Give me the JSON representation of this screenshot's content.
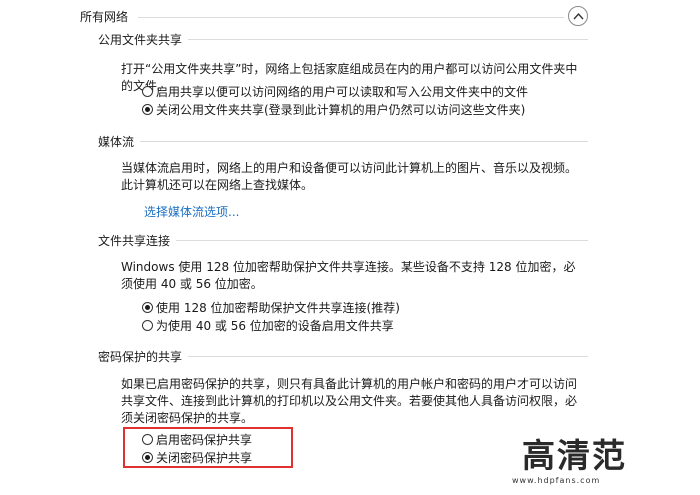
{
  "header": {
    "title": "所有网络",
    "collapse_icon": "chevron-up-icon"
  },
  "public_folder": {
    "title": "公用文件夹共享",
    "desc": "打开“公用文件夹共享”时，网络上包括家庭组成员在内的用户都可以访问公用文件夹中的文件。",
    "options": [
      {
        "label": "启用共享以便可以访问网络的用户可以读取和写入公用文件夹中的文件",
        "checked": false
      },
      {
        "label": "关闭公用文件夹共享(登录到此计算机的用户仍然可以访问这些文件夹)",
        "checked": true
      }
    ]
  },
  "media": {
    "title": "媒体流",
    "desc": "当媒体流启用时，网络上的用户和设备便可以访问此计算机上的图片、音乐以及视频。此计算机还可以在网络上查找媒体。",
    "link": "选择媒体流选项..."
  },
  "file_sharing": {
    "title": "文件共享连接",
    "desc": "Windows 使用 128 位加密帮助保护文件共享连接。某些设备不支持 128 位加密，必须使用 40 或 56 位加密。",
    "options": [
      {
        "label": "使用 128 位加密帮助保护文件共享连接(推荐)",
        "checked": true
      },
      {
        "label": "为使用 40 或 56 位加密的设备启用文件共享",
        "checked": false
      }
    ]
  },
  "password": {
    "title": "密码保护的共享",
    "desc": "如果已启用密码保护的共享，则只有具备此计算机的用户帐户和密码的用户才可以访问共享文件、连接到此计算机的打印机以及公用文件夹。若要使其他人具备访问权限，必须关闭密码保护的共享。",
    "options": [
      {
        "label": "启用密码保护共享",
        "checked": false
      },
      {
        "label": "关闭密码保护共享",
        "checked": true
      }
    ]
  },
  "watermark": {
    "text": "高清范",
    "url": "www.hdpfans.com"
  },
  "colors": {
    "link": "#1a6fc4",
    "highlight": "#e03030",
    "divider": "#dcdcdc"
  }
}
